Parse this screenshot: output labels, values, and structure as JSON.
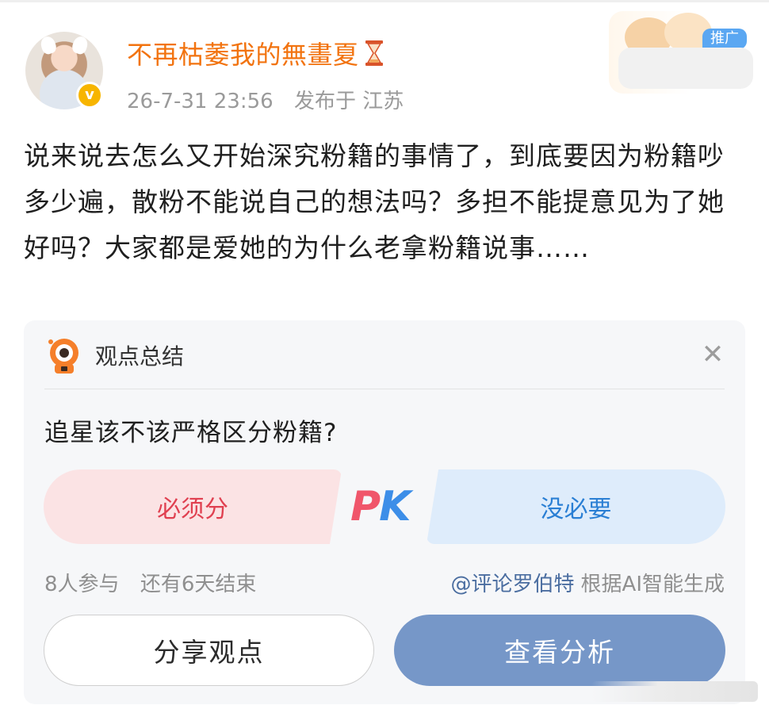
{
  "post": {
    "username": "不再枯萎我的無畫夏",
    "time": "26-7-31 23:56",
    "location": "发布于 江苏",
    "text": "说来说去怎么又开始深究粉籍的事情了，到底要因为粉籍吵多少遍，散粉不能说自己的想法吗？多担不能提意见为了她好吗？大家都是爱她的为什么老拿粉籍说事……",
    "ad_tag": "推广"
  },
  "card": {
    "title": "观点总结",
    "close_icon": "close-icon",
    "question": "追星该不该严格区分粉籍?",
    "option_left": "必须分",
    "option_right": "没必要",
    "pk_p": "P",
    "pk_k": "K",
    "participants": "8人参与",
    "remaining": "还有6天结束",
    "bot_handle": "@评论罗伯特",
    "generated_note": "根据AI智能生成",
    "share_button": "分享观点",
    "view_button": "查看分析"
  },
  "colors": {
    "username": "#f2730f",
    "pk_p": "#f0566b",
    "pk_k": "#3d8ee8",
    "view_button_bg": "#7697c8",
    "option_left_bg": "#fbe3e4",
    "option_right_bg": "#deecfb"
  }
}
